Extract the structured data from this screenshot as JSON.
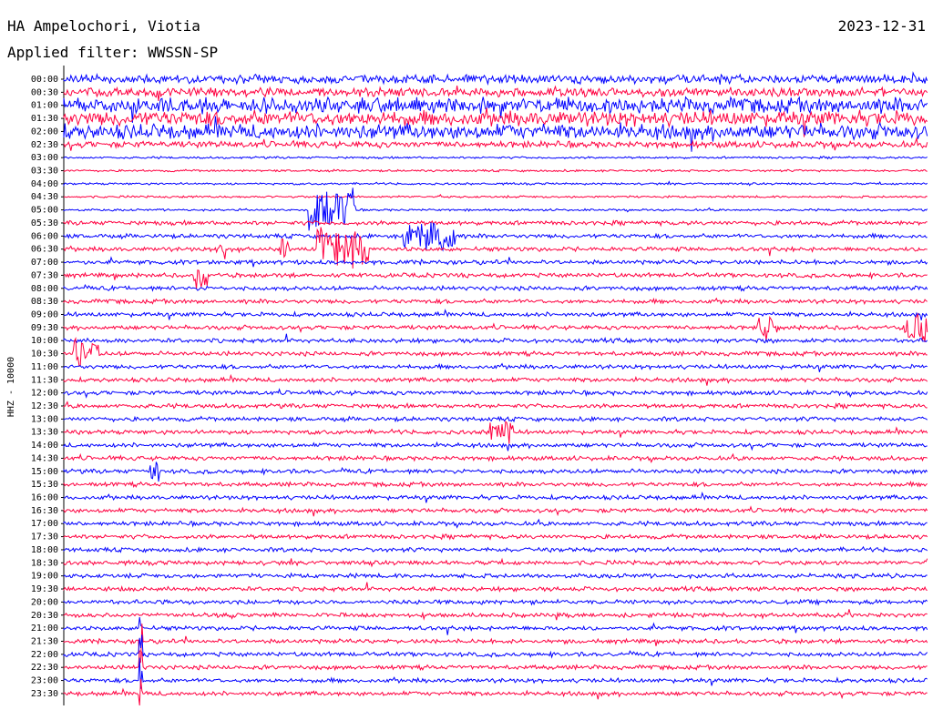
{
  "header": {
    "station": "HA Ampelochori, Viotia",
    "date": "2023-12-31",
    "filter": "Applied filter: WWSSN-SP"
  },
  "chart_data": {
    "type": "line",
    "title": "HA Ampelochori, Viotia",
    "subtitle": "Applied filter: WWSSN-SP",
    "date": "2023-12-31",
    "ylabel": "HHZ - 10000",
    "row_labels": [
      "00:00",
      "00:30",
      "01:00",
      "01:30",
      "02:00",
      "02:30",
      "03:00",
      "03:30",
      "04:00",
      "04:30",
      "05:00",
      "05:30",
      "06:00",
      "06:30",
      "07:00",
      "07:30",
      "08:00",
      "08:30",
      "09:00",
      "09:30",
      "10:00",
      "10:30",
      "11:00",
      "11:30",
      "12:00",
      "12:30",
      "13:00",
      "13:30",
      "14:00",
      "14:30",
      "15:00",
      "15:30",
      "16:00",
      "16:30",
      "17:00",
      "17:30",
      "18:00",
      "18:30",
      "19:00",
      "19:30",
      "20:00",
      "20:30",
      "21:00",
      "21:30",
      "22:00",
      "22:30",
      "23:00",
      "23:30"
    ],
    "row_colors": [
      "#0000ff",
      "#ff0040"
    ],
    "minutes_per_row": 30,
    "noise_level_by_row": [
      4,
      4,
      7,
      7,
      7,
      3,
      1,
      1,
      1,
      1,
      1,
      2,
      2,
      2,
      2,
      2,
      2,
      2,
      2,
      2,
      2,
      2,
      2,
      2,
      2,
      2,
      2,
      2,
      2,
      2,
      2,
      2,
      2,
      2,
      2,
      2,
      2,
      2,
      2,
      2,
      2,
      2,
      2,
      2,
      2,
      2,
      2,
      2
    ],
    "events": [
      {
        "row": "05:00",
        "minute": 8.5,
        "duration_min": 1.7,
        "amplitude": 3
      },
      {
        "row": "06:00",
        "minute": 11.8,
        "duration_min": 1.8,
        "amplitude": 2
      },
      {
        "row": "06:30",
        "minute": 8.8,
        "duration_min": 1.8,
        "amplitude": 3
      },
      {
        "row": "06:30",
        "minute": 5.3,
        "duration_min": 0.3,
        "amplitude": 2
      },
      {
        "row": "06:30",
        "minute": 7.5,
        "duration_min": 0.3,
        "amplitude": 2
      },
      {
        "row": "07:30",
        "minute": 4.5,
        "duration_min": 0.5,
        "amplitude": 2
      },
      {
        "row": "09:30",
        "minute": 24.0,
        "duration_min": 0.7,
        "amplitude": 2
      },
      {
        "row": "09:30",
        "minute": 29.2,
        "duration_min": 0.8,
        "amplitude": 2
      },
      {
        "row": "10:30",
        "minute": 0.3,
        "duration_min": 0.9,
        "amplitude": 2
      },
      {
        "row": "13:30",
        "minute": 14.8,
        "duration_min": 0.8,
        "amplitude": 2
      },
      {
        "row": "15:00",
        "minute": 3.0,
        "duration_min": 0.3,
        "amplitude": 1.5
      },
      {
        "row": "21:00",
        "minute": 2.6,
        "duration_min": 0.15,
        "amplitude": 4
      },
      {
        "row": "21:30",
        "minute": 2.6,
        "duration_min": 0.15,
        "amplitude": 4
      },
      {
        "row": "22:00",
        "minute": 2.6,
        "duration_min": 0.15,
        "amplitude": 4
      },
      {
        "row": "22:30",
        "minute": 2.6,
        "duration_min": 0.15,
        "amplitude": 4
      },
      {
        "row": "23:00",
        "minute": 2.6,
        "duration_min": 0.15,
        "amplitude": 4
      },
      {
        "row": "23:30",
        "minute": 2.6,
        "duration_min": 0.15,
        "amplitude": 4
      }
    ]
  }
}
